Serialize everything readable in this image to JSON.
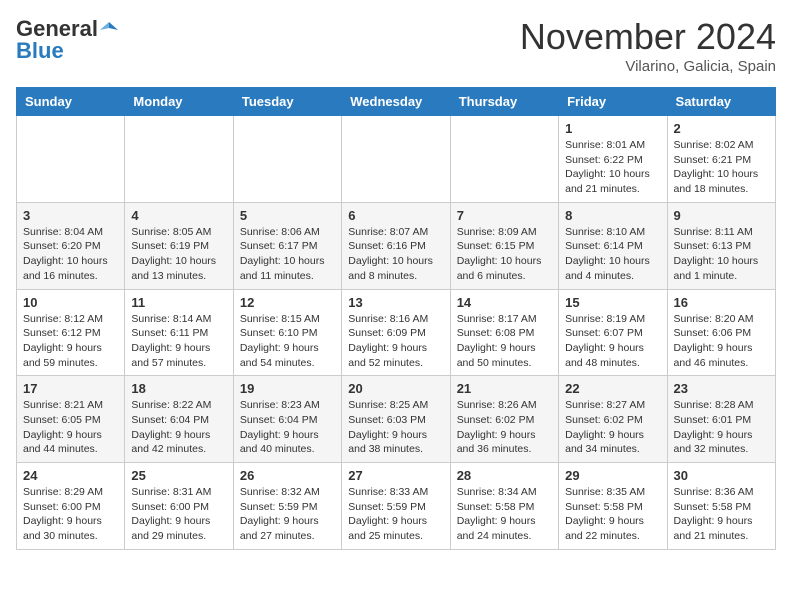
{
  "header": {
    "logo_general": "General",
    "logo_blue": "Blue",
    "month": "November 2024",
    "location": "Vilarino, Galicia, Spain"
  },
  "days_of_week": [
    "Sunday",
    "Monday",
    "Tuesday",
    "Wednesday",
    "Thursday",
    "Friday",
    "Saturday"
  ],
  "weeks": [
    [
      {
        "day": "",
        "info": ""
      },
      {
        "day": "",
        "info": ""
      },
      {
        "day": "",
        "info": ""
      },
      {
        "day": "",
        "info": ""
      },
      {
        "day": "",
        "info": ""
      },
      {
        "day": "1",
        "info": "Sunrise: 8:01 AM\nSunset: 6:22 PM\nDaylight: 10 hours and 21 minutes."
      },
      {
        "day": "2",
        "info": "Sunrise: 8:02 AM\nSunset: 6:21 PM\nDaylight: 10 hours and 18 minutes."
      }
    ],
    [
      {
        "day": "3",
        "info": "Sunrise: 8:04 AM\nSunset: 6:20 PM\nDaylight: 10 hours and 16 minutes."
      },
      {
        "day": "4",
        "info": "Sunrise: 8:05 AM\nSunset: 6:19 PM\nDaylight: 10 hours and 13 minutes."
      },
      {
        "day": "5",
        "info": "Sunrise: 8:06 AM\nSunset: 6:17 PM\nDaylight: 10 hours and 11 minutes."
      },
      {
        "day": "6",
        "info": "Sunrise: 8:07 AM\nSunset: 6:16 PM\nDaylight: 10 hours and 8 minutes."
      },
      {
        "day": "7",
        "info": "Sunrise: 8:09 AM\nSunset: 6:15 PM\nDaylight: 10 hours and 6 minutes."
      },
      {
        "day": "8",
        "info": "Sunrise: 8:10 AM\nSunset: 6:14 PM\nDaylight: 10 hours and 4 minutes."
      },
      {
        "day": "9",
        "info": "Sunrise: 8:11 AM\nSunset: 6:13 PM\nDaylight: 10 hours and 1 minute."
      }
    ],
    [
      {
        "day": "10",
        "info": "Sunrise: 8:12 AM\nSunset: 6:12 PM\nDaylight: 9 hours and 59 minutes."
      },
      {
        "day": "11",
        "info": "Sunrise: 8:14 AM\nSunset: 6:11 PM\nDaylight: 9 hours and 57 minutes."
      },
      {
        "day": "12",
        "info": "Sunrise: 8:15 AM\nSunset: 6:10 PM\nDaylight: 9 hours and 54 minutes."
      },
      {
        "day": "13",
        "info": "Sunrise: 8:16 AM\nSunset: 6:09 PM\nDaylight: 9 hours and 52 minutes."
      },
      {
        "day": "14",
        "info": "Sunrise: 8:17 AM\nSunset: 6:08 PM\nDaylight: 9 hours and 50 minutes."
      },
      {
        "day": "15",
        "info": "Sunrise: 8:19 AM\nSunset: 6:07 PM\nDaylight: 9 hours and 48 minutes."
      },
      {
        "day": "16",
        "info": "Sunrise: 8:20 AM\nSunset: 6:06 PM\nDaylight: 9 hours and 46 minutes."
      }
    ],
    [
      {
        "day": "17",
        "info": "Sunrise: 8:21 AM\nSunset: 6:05 PM\nDaylight: 9 hours and 44 minutes."
      },
      {
        "day": "18",
        "info": "Sunrise: 8:22 AM\nSunset: 6:04 PM\nDaylight: 9 hours and 42 minutes."
      },
      {
        "day": "19",
        "info": "Sunrise: 8:23 AM\nSunset: 6:04 PM\nDaylight: 9 hours and 40 minutes."
      },
      {
        "day": "20",
        "info": "Sunrise: 8:25 AM\nSunset: 6:03 PM\nDaylight: 9 hours and 38 minutes."
      },
      {
        "day": "21",
        "info": "Sunrise: 8:26 AM\nSunset: 6:02 PM\nDaylight: 9 hours and 36 minutes."
      },
      {
        "day": "22",
        "info": "Sunrise: 8:27 AM\nSunset: 6:02 PM\nDaylight: 9 hours and 34 minutes."
      },
      {
        "day": "23",
        "info": "Sunrise: 8:28 AM\nSunset: 6:01 PM\nDaylight: 9 hours and 32 minutes."
      }
    ],
    [
      {
        "day": "24",
        "info": "Sunrise: 8:29 AM\nSunset: 6:00 PM\nDaylight: 9 hours and 30 minutes."
      },
      {
        "day": "25",
        "info": "Sunrise: 8:31 AM\nSunset: 6:00 PM\nDaylight: 9 hours and 29 minutes."
      },
      {
        "day": "26",
        "info": "Sunrise: 8:32 AM\nSunset: 5:59 PM\nDaylight: 9 hours and 27 minutes."
      },
      {
        "day": "27",
        "info": "Sunrise: 8:33 AM\nSunset: 5:59 PM\nDaylight: 9 hours and 25 minutes."
      },
      {
        "day": "28",
        "info": "Sunrise: 8:34 AM\nSunset: 5:58 PM\nDaylight: 9 hours and 24 minutes."
      },
      {
        "day": "29",
        "info": "Sunrise: 8:35 AM\nSunset: 5:58 PM\nDaylight: 9 hours and 22 minutes."
      },
      {
        "day": "30",
        "info": "Sunrise: 8:36 AM\nSunset: 5:58 PM\nDaylight: 9 hours and 21 minutes."
      }
    ]
  ]
}
